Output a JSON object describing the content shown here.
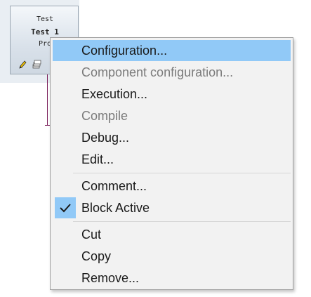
{
  "block": {
    "type": "Test",
    "name": "Test 1",
    "sub": "Pro",
    "icons": [
      "pencil-icon",
      "stack-icon"
    ]
  },
  "menu": {
    "items": [
      {
        "label": "Configuration...",
        "enabled": true,
        "highlighted": true
      },
      {
        "label": "Component configuration...",
        "enabled": false
      },
      {
        "label": "Execution...",
        "enabled": true
      },
      {
        "label": "Compile",
        "enabled": false
      },
      {
        "label": "Debug...",
        "enabled": true
      },
      {
        "label": "Edit...",
        "enabled": true
      },
      {
        "label": "Comment...",
        "enabled": true
      },
      {
        "label": "Block Active",
        "enabled": true,
        "checked": true
      },
      {
        "label": "Cut",
        "enabled": true
      },
      {
        "label": "Copy",
        "enabled": true
      },
      {
        "label": "Remove...",
        "enabled": true
      }
    ]
  },
  "colors": {
    "menu_bg": "#f2f2f2",
    "highlight": "#91c9f7",
    "disabled_text": "#7b7b7b",
    "wire": "#7a1d5a"
  }
}
